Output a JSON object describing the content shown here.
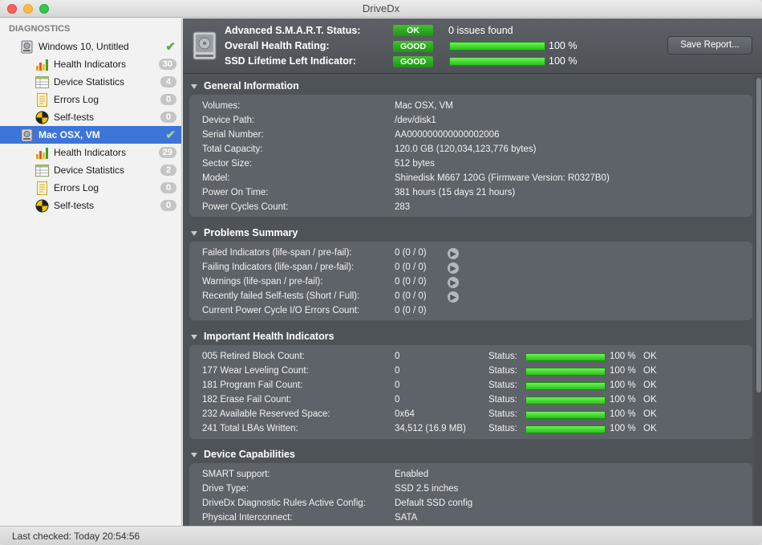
{
  "window": {
    "title": "DriveDx"
  },
  "sidebar": {
    "header": "DIAGNOSTICS",
    "drives": [
      {
        "name": "Windows 10, Untitled",
        "status": "ok",
        "items": [
          {
            "label": "Health Indicators",
            "icon": "health-indicators-icon",
            "count": "30"
          },
          {
            "label": "Device Statistics",
            "icon": "device-statistics-icon",
            "count": "4"
          },
          {
            "label": "Errors Log",
            "icon": "errors-log-icon",
            "count": "0"
          },
          {
            "label": "Self-tests",
            "icon": "self-tests-icon",
            "count": "0"
          }
        ]
      },
      {
        "name": "Mac OSX, VM",
        "status": "ok",
        "selected": true,
        "items": [
          {
            "label": "Health Indicators",
            "icon": "health-indicators-icon",
            "count": "29"
          },
          {
            "label": "Device Statistics",
            "icon": "device-statistics-icon",
            "count": "2"
          },
          {
            "label": "Errors Log",
            "icon": "errors-log-icon",
            "count": "0"
          },
          {
            "label": "Self-tests",
            "icon": "self-tests-icon",
            "count": "0"
          }
        ]
      }
    ]
  },
  "header": {
    "smart_label": "Advanced S.M.A.R.T. Status:",
    "smart_badge": "OK",
    "smart_text": "0 issues found",
    "health_label": "Overall Health Rating:",
    "health_badge": "GOOD",
    "health_pct": "100 %",
    "health_value": 1.0,
    "ssd_label": "SSD Lifetime Left Indicator:",
    "ssd_badge": "GOOD",
    "ssd_pct": "100 %",
    "ssd_value": 1.0,
    "save_button": "Save Report..."
  },
  "general": {
    "title": "General Information",
    "rows": [
      {
        "k": "Volumes:",
        "v": "Mac OSX, VM"
      },
      {
        "k": "Device Path:",
        "v": "/dev/disk1"
      },
      {
        "k": "Serial Number:",
        "v": "AA000000000000002006"
      },
      {
        "k": "Total Capacity:",
        "v": "120.0 GB (120,034,123,776 bytes)"
      },
      {
        "k": "Sector Size:",
        "v": "512 bytes"
      },
      {
        "k": "Model:",
        "v": "Shinedisk M667 120G  (Firmware Version: R0327B0)"
      },
      {
        "k": "Power On Time:",
        "v": "381 hours (15 days 21 hours)"
      },
      {
        "k": "Power Cycles Count:",
        "v": "283"
      }
    ]
  },
  "problems": {
    "title": "Problems Summary",
    "rows": [
      {
        "k": "Failed Indicators (life-span / pre-fail):",
        "v": "0 (0 / 0)",
        "arrow": true
      },
      {
        "k": "Failing Indicators (life-span / pre-fail):",
        "v": "0 (0 / 0)",
        "arrow": true
      },
      {
        "k": "Warnings (life-span / pre-fail):",
        "v": "0 (0 / 0)",
        "arrow": true
      },
      {
        "k": "Recently failed Self-tests (Short / Full):",
        "v": "0 (0 / 0)",
        "arrow": true
      },
      {
        "k": "Current Power Cycle I/O Errors Count:",
        "v": "0 (0 / 0)",
        "arrow": false
      }
    ]
  },
  "indicators": {
    "title": "Important Health Indicators",
    "status_label": "Status:",
    "rows": [
      {
        "k": "005  Retired Block Count:",
        "v": "0",
        "pct": "100 %",
        "ok": "OK",
        "value": 1.0
      },
      {
        "k": "177  Wear Leveling Count:",
        "v": "0",
        "pct": "100 %",
        "ok": "OK",
        "value": 1.0
      },
      {
        "k": "181  Program Fail Count:",
        "v": "0",
        "pct": "100 %",
        "ok": "OK",
        "value": 1.0
      },
      {
        "k": "182  Erase Fail Count:",
        "v": "0",
        "pct": "100 %",
        "ok": "OK",
        "value": 1.0
      },
      {
        "k": "232  Available Reserved Space:",
        "v": "0x64",
        "pct": "100 %",
        "ok": "OK",
        "value": 1.0
      },
      {
        "k": "241  Total LBAs Written:",
        "v": "34,512 (16.9 MB)",
        "pct": "100 %",
        "ok": "OK",
        "value": 1.0
      }
    ]
  },
  "capabilities": {
    "title": "Device Capabilities",
    "rows": [
      {
        "k": "SMART support:",
        "v": "Enabled"
      },
      {
        "k": "Drive Type:",
        "v": "SSD 2.5 inches"
      },
      {
        "k": "DriveDx Diagnostic Rules Active Config:",
        "v": "Default SSD config"
      },
      {
        "k": "Physical Interconnect:",
        "v": "SATA"
      }
    ]
  },
  "statusbar": {
    "text": "Last checked: Today 20:54:56"
  }
}
